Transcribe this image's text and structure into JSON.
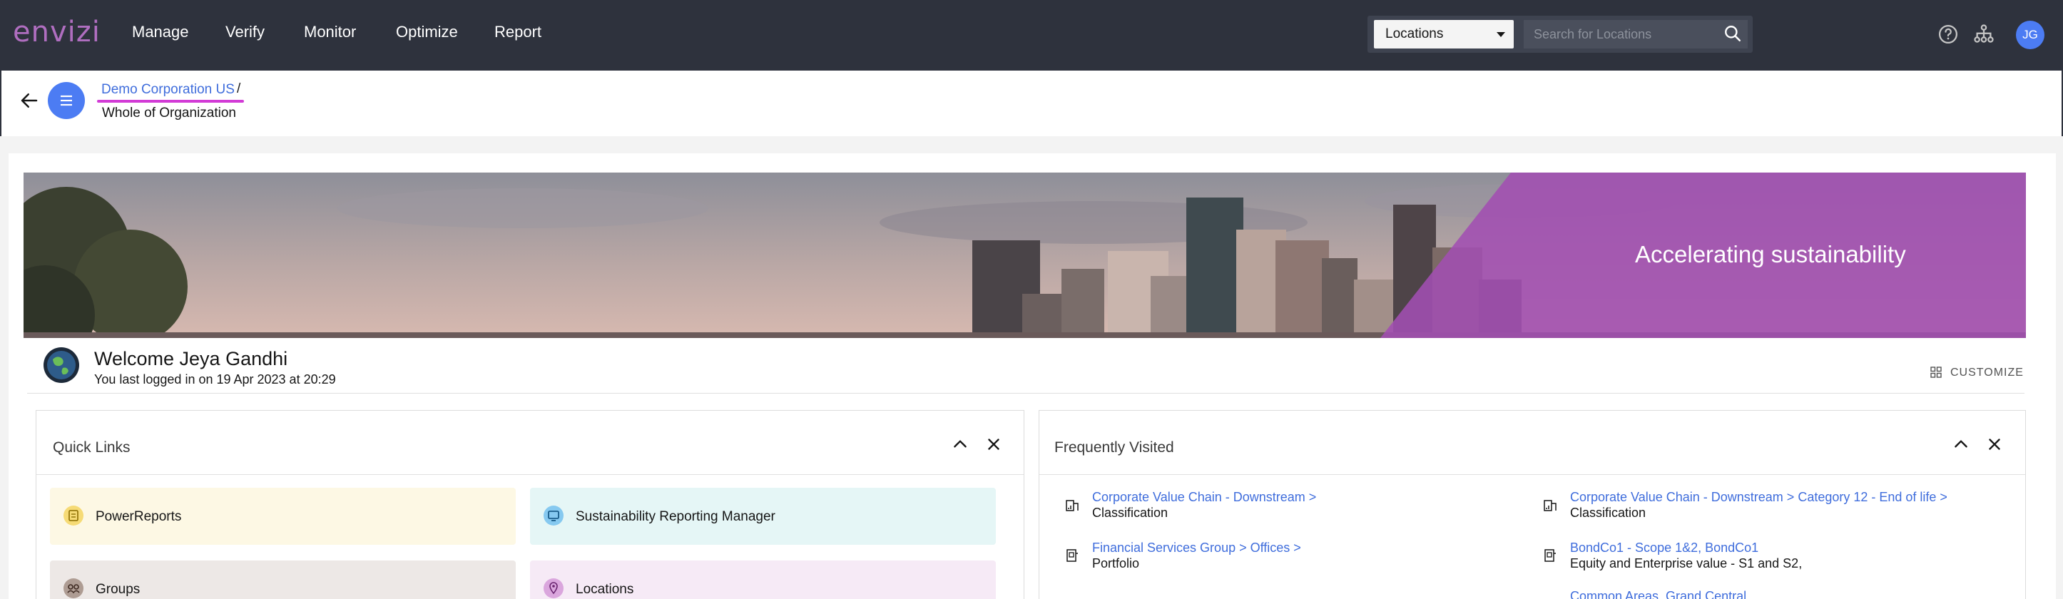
{
  "nav": {
    "logo": "envizi",
    "items": [
      "Manage",
      "Verify",
      "Monitor",
      "Optimize",
      "Report"
    ],
    "search_scope": "Locations",
    "search_placeholder": "Search for Locations",
    "avatar_initials": "JG"
  },
  "breadcrumb": {
    "parent": "Demo Corporation US",
    "separator": "/",
    "current": "Whole of Organization"
  },
  "banner": {
    "tagline": "Accelerating sustainability",
    "accent_color": "#a24eb2"
  },
  "welcome": {
    "title": "Welcome Jeya Gandhi",
    "last_login": "You last logged in on 19 Apr 2023 at 20:29",
    "customize_label": "CUSTOMIZE"
  },
  "quick_links": {
    "title": "Quick Links",
    "items": [
      {
        "label": "PowerReports",
        "icon": "report-icon",
        "bg": "#fdf8e4",
        "icon_color": "#f1c21b"
      },
      {
        "label": "Sustainability Reporting Manager",
        "icon": "monitor-icon",
        "bg": "#e5f6f6",
        "icon_color": "#1192e8"
      },
      {
        "label": "Groups",
        "icon": "groups-icon",
        "bg": "#ede8e6",
        "icon_color": "#7a5c4f"
      },
      {
        "label": "Locations",
        "icon": "location-icon",
        "bg": "#f6eaf6",
        "icon_color": "#c26ec8"
      }
    ]
  },
  "frequently_visited": {
    "title": "Frequently Visited",
    "items": [
      {
        "link": "Corporate Value Chain - Downstream >",
        "sub": "Classification",
        "icon": "building-chart-icon"
      },
      {
        "link": "Corporate Value Chain - Downstream > Category 12 - End of life >",
        "sub": "Classification",
        "icon": "building-chart-icon"
      },
      {
        "link": "Financial Services Group > Offices >",
        "sub": "Portfolio",
        "icon": "portfolio-icon"
      },
      {
        "link": "BondCo1 - Scope 1&2, BondCo1",
        "sub": "Equity and Enterprise value - S1 and S2,",
        "icon": "portfolio-icon"
      },
      {
        "link": "Common Areas, Grand Central",
        "sub": "",
        "icon": "building-chart-icon"
      }
    ]
  }
}
